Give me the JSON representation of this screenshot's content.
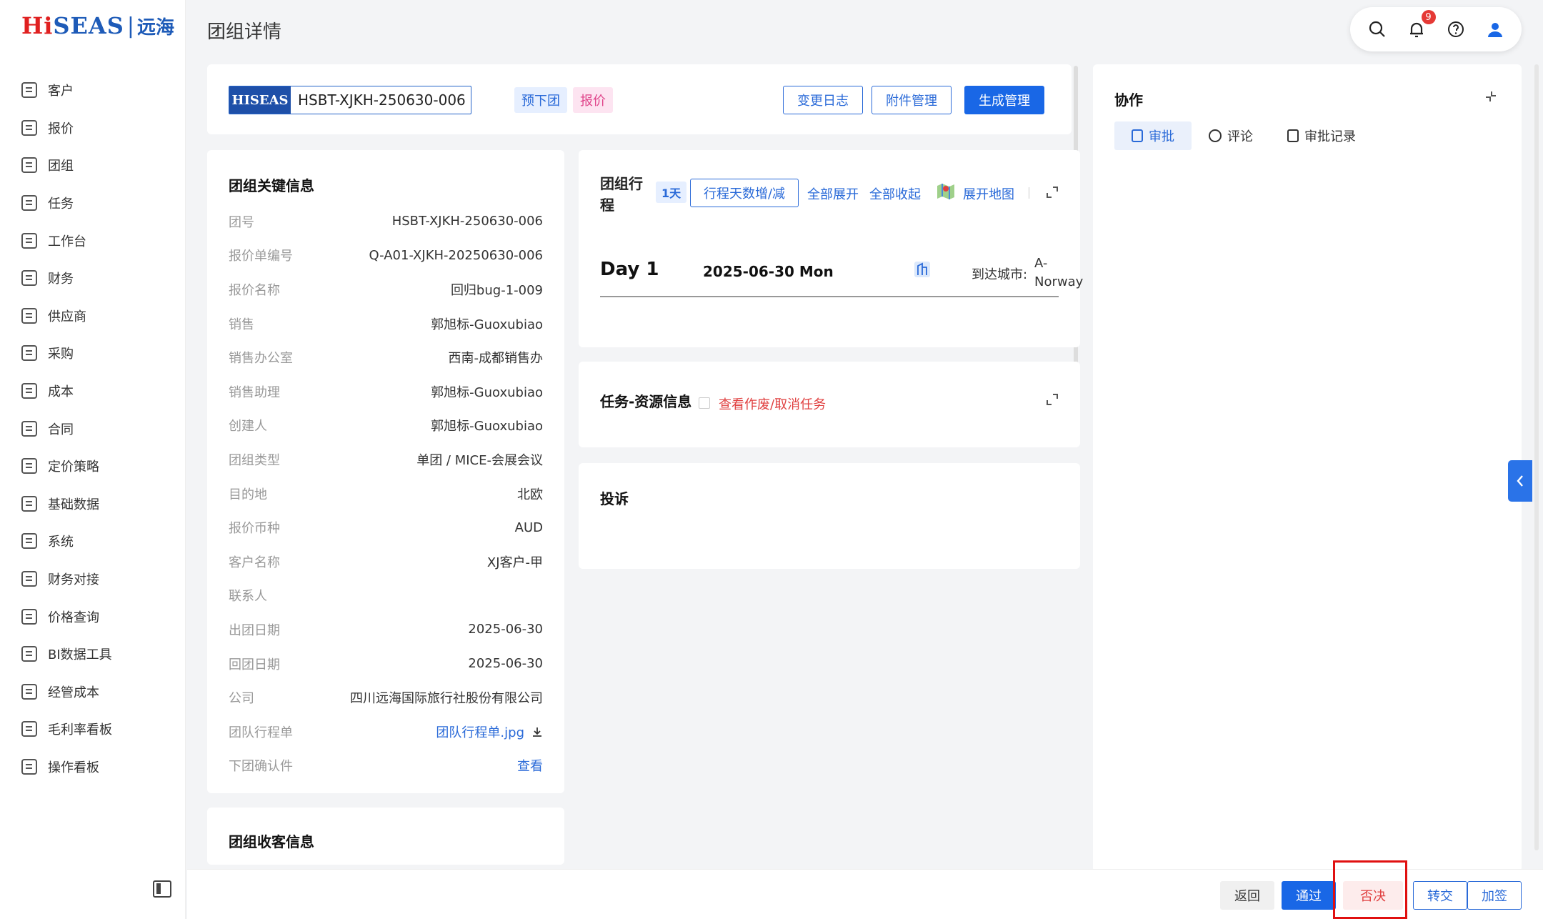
{
  "brand": {
    "logo_hi": "Hi",
    "logo_rest": "SEAS",
    "logo_sep": "|",
    "logo_cn": "远海"
  },
  "sidebar": {
    "items": [
      {
        "label": "客户",
        "icon": "customer-icon"
      },
      {
        "label": "报价",
        "icon": "quote-icon"
      },
      {
        "label": "团组",
        "icon": "group-icon"
      },
      {
        "label": "任务",
        "icon": "task-icon"
      },
      {
        "label": "工作台",
        "icon": "workbench-icon"
      },
      {
        "label": "财务",
        "icon": "finance-icon"
      },
      {
        "label": "供应商",
        "icon": "supplier-icon"
      },
      {
        "label": "采购",
        "icon": "purchase-icon"
      },
      {
        "label": "成本",
        "icon": "cost-icon"
      },
      {
        "label": "合同",
        "icon": "contract-icon"
      },
      {
        "label": "定价策略",
        "icon": "pricing-icon"
      },
      {
        "label": "基础数据",
        "icon": "base-data-icon"
      },
      {
        "label": "系统",
        "icon": "system-icon"
      },
      {
        "label": "财务对接",
        "icon": "finance-link-icon"
      },
      {
        "label": "价格查询",
        "icon": "price-search-icon"
      },
      {
        "label": "BI数据工具",
        "icon": "bi-icon"
      },
      {
        "label": "经管成本",
        "icon": "mgmt-cost-icon"
      },
      {
        "label": "毛利率看板",
        "icon": "margin-board-icon"
      },
      {
        "label": "操作看板",
        "icon": "ops-board-icon"
      }
    ]
  },
  "header": {
    "title": "团组详情",
    "notification_count": "9"
  },
  "group": {
    "brand_tag": "HISEAS",
    "code": "HSBT-XJKH-250630-006",
    "tag_pre": "预下团",
    "tag_quote": "报价",
    "btn_changelog": "变更日志",
    "btn_attachments": "附件管理",
    "btn_generate": "生成管理"
  },
  "info": {
    "title": "团组关键信息",
    "rows": [
      {
        "label": "团号",
        "value": "HSBT-XJKH-250630-006"
      },
      {
        "label": "报价单编号",
        "value": "Q-A01-XJKH-20250630-006"
      },
      {
        "label": "报价名称",
        "value": "回归bug-1-009"
      },
      {
        "label": "销售",
        "value": "郭旭标-Guoxubiao"
      },
      {
        "label": "销售办公室",
        "value": "西南-成都销售办"
      },
      {
        "label": "销售助理",
        "value": "郭旭标-Guoxubiao"
      },
      {
        "label": "创建人",
        "value": "郭旭标-Guoxubiao"
      },
      {
        "label": "团组类型",
        "value": "单团 / MICE-会展会议"
      },
      {
        "label": "目的地",
        "value": "北欧"
      },
      {
        "label": "报价币种",
        "value": "AUD"
      },
      {
        "label": "客户名称",
        "value": "XJ客户-甲"
      },
      {
        "label": "联系人",
        "value": ""
      },
      {
        "label": "出团日期",
        "value": "2025-06-30"
      },
      {
        "label": "回团日期",
        "value": "2025-06-30"
      },
      {
        "label": "公司",
        "value": "四川远海国际旅行社股份有限公司"
      }
    ],
    "itinerary_label": "团队行程单",
    "itinerary_file": "团队行程单.jpg",
    "confirm_label": "下团确认件",
    "confirm_link": "查看"
  },
  "receive": {
    "title": "团组收客信息"
  },
  "itinerary": {
    "title": "团组行程",
    "days_badge": "1天",
    "adjust_btn": "行程天数增/减",
    "expand_all": "全部展开",
    "collapse_all": "全部收起",
    "map_link": "展开地图",
    "day_label": "Day 1",
    "day_date": "2025-06-30 Mon",
    "city_label": "到达城市:",
    "city_value": "A-Norway"
  },
  "task": {
    "title": "任务-资源信息",
    "link": "查看作废/取消任务"
  },
  "complaint": {
    "title": "投诉"
  },
  "collab": {
    "title": "协作",
    "tabs": [
      {
        "label": "审批"
      },
      {
        "label": "评论"
      },
      {
        "label": "审批记录"
      }
    ]
  },
  "footer": {
    "back": "返回",
    "approve": "通过",
    "reject": "否决",
    "transfer": "转交",
    "countersign": "加签"
  },
  "colors": {
    "primary": "#1967e6",
    "reject_bg": "#fdecec",
    "reject_text": "#e04040",
    "highlight": "#e01010"
  }
}
